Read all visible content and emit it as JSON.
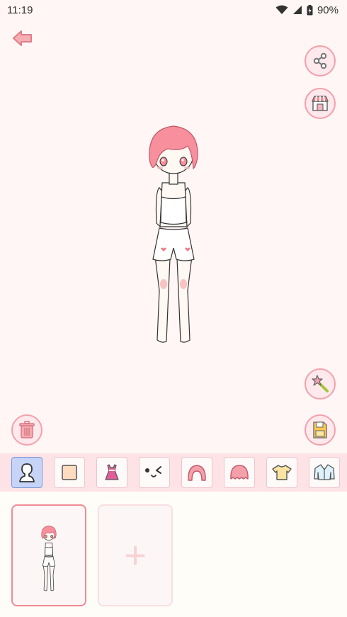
{
  "status_bar": {
    "time": "11:19",
    "battery": "90%"
  },
  "icons": {
    "back": "back-arrow-icon",
    "share": "share-icon",
    "shop": "shop-icon",
    "magic": "magic-wand-icon",
    "trash": "trash-icon",
    "save": "save-icon",
    "wifi": "wifi-icon",
    "signal": "signal-icon",
    "battery": "battery-icon"
  },
  "categories": [
    {
      "name": "body",
      "icon": "body-silhouette-icon",
      "active": true
    },
    {
      "name": "skin-color",
      "icon": "skin-swatch-icon"
    },
    {
      "name": "dress",
      "icon": "dress-icon"
    },
    {
      "name": "face",
      "icon": "face-expression-icon"
    },
    {
      "name": "back-hair",
      "icon": "back-hair-icon"
    },
    {
      "name": "front-hair",
      "icon": "front-hair-icon"
    },
    {
      "name": "top",
      "icon": "tshirt-icon"
    },
    {
      "name": "jacket",
      "icon": "jacket-icon"
    }
  ],
  "slots": {
    "add_label": "+"
  },
  "colors": {
    "accent": "#f08b94",
    "background": "#fff6f5",
    "tab_bar": "#fde3e6",
    "active_tab": "#c6d4f7"
  }
}
